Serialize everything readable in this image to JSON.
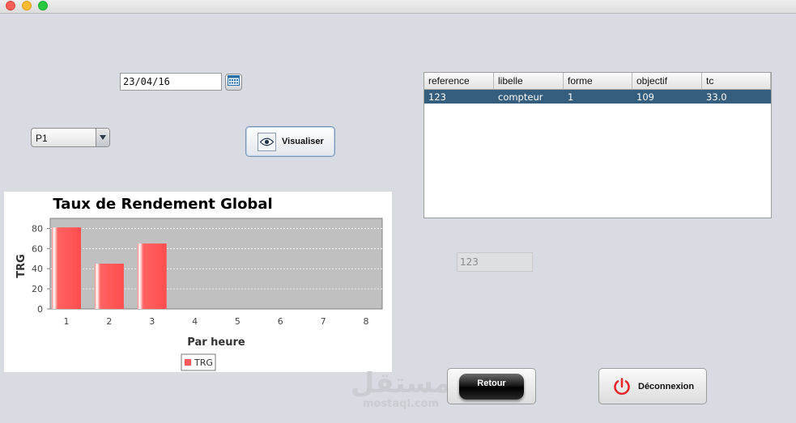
{
  "window": {
    "controls": [
      "close",
      "minimize",
      "zoom"
    ]
  },
  "date_picker": {
    "value": "23/04/16",
    "icon": "calendar-icon"
  },
  "combo": {
    "selected": "P1"
  },
  "visualize_button": {
    "label": "Visualiser",
    "icon": "eye-icon"
  },
  "table": {
    "columns": [
      "reference",
      "libelle",
      "forme",
      "objectif",
      "tc"
    ],
    "rows": [
      [
        "123",
        "compteur",
        "1",
        "109",
        "33.0"
      ]
    ],
    "selected_row_color": "#355d7d"
  },
  "readonly_field": {
    "value": "123"
  },
  "retour_button": {
    "label": "Retour"
  },
  "logout_button": {
    "label": "Déconnexion",
    "icon": "power-icon",
    "icon_color": "#e8282b"
  },
  "watermark": {
    "arabic": "مستقل",
    "latin": "mostaql.com"
  },
  "chart_data": {
    "type": "bar",
    "title": "Taux de Rendement Global",
    "xlabel": "Par heure",
    "ylabel": "TRG",
    "categories": [
      "1",
      "2",
      "3",
      "4",
      "5",
      "6",
      "7",
      "8"
    ],
    "series": [
      {
        "name": "TRG",
        "values": [
          81,
          45,
          65,
          null,
          null,
          null,
          null,
          null
        ],
        "color": "#ff5a5a"
      }
    ],
    "ylim": [
      0,
      90
    ],
    "yticks": [
      0,
      20,
      40,
      60,
      80
    ],
    "grid": true,
    "plot_background": "#c0c0c0",
    "legend_position": "bottom"
  }
}
